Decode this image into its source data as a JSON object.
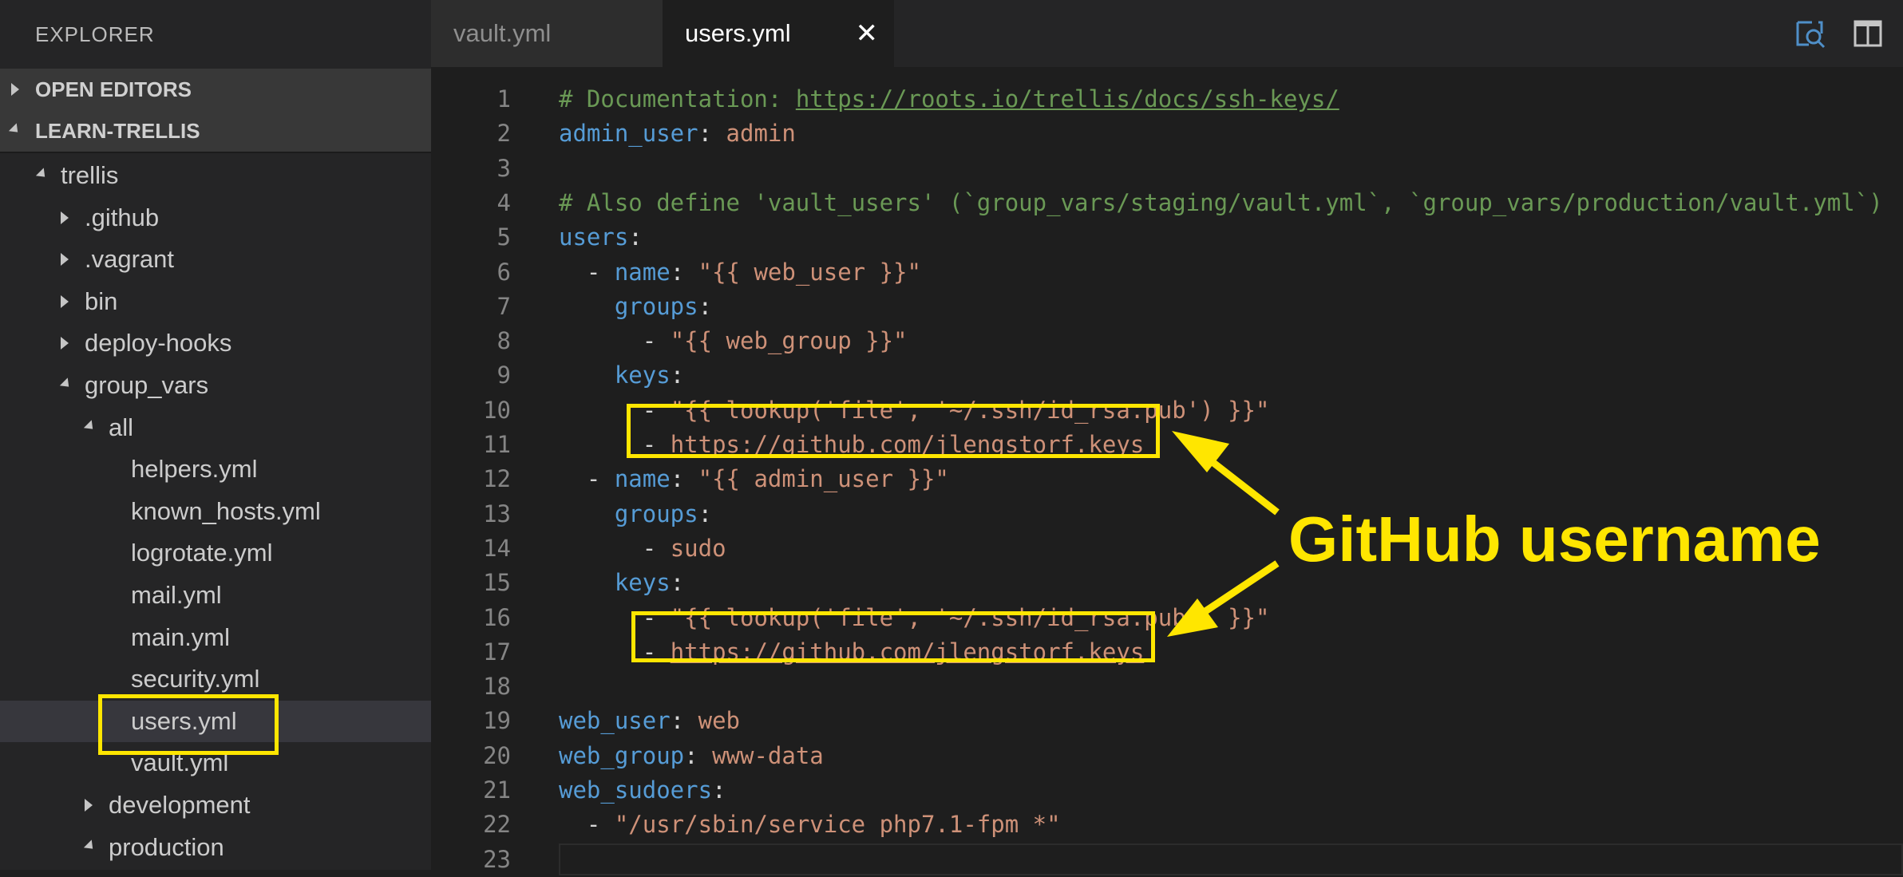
{
  "sidebar": {
    "title": "EXPLORER",
    "sections": [
      {
        "label": "OPEN EDITORS",
        "expanded": false
      },
      {
        "label": "LEARN-TRELLIS",
        "expanded": true
      }
    ],
    "tree": [
      {
        "label": "trellis",
        "type": "folder",
        "expanded": true
      },
      {
        "label": ".github",
        "type": "folder",
        "expanded": false
      },
      {
        "label": ".vagrant",
        "type": "folder",
        "expanded": false
      },
      {
        "label": "bin",
        "type": "folder",
        "expanded": false
      },
      {
        "label": "deploy-hooks",
        "type": "folder",
        "expanded": false
      },
      {
        "label": "group_vars",
        "type": "folder",
        "expanded": true
      },
      {
        "label": "all",
        "type": "folder",
        "expanded": true
      },
      {
        "label": "helpers.yml",
        "type": "file"
      },
      {
        "label": "known_hosts.yml",
        "type": "file"
      },
      {
        "label": "logrotate.yml",
        "type": "file"
      },
      {
        "label": "mail.yml",
        "type": "file"
      },
      {
        "label": "main.yml",
        "type": "file"
      },
      {
        "label": "security.yml",
        "type": "file"
      },
      {
        "label": "users.yml",
        "type": "file",
        "selected": true
      },
      {
        "label": "vault.yml",
        "type": "file"
      },
      {
        "label": "development",
        "type": "folder",
        "expanded": false
      },
      {
        "label": "production",
        "type": "folder",
        "expanded": true
      }
    ]
  },
  "tabs": [
    {
      "label": "vault.yml",
      "active": false
    },
    {
      "label": "users.yml",
      "active": true,
      "close": "✕"
    }
  ],
  "editor": {
    "lines": [
      {
        "n": "1",
        "parts": [
          {
            "t": "# Documentation: ",
            "c": "c"
          },
          {
            "t": "https://roots.io/trellis/docs/ssh-keys/",
            "c": "cl"
          }
        ]
      },
      {
        "n": "2",
        "parts": [
          {
            "t": "admin_user",
            "c": "k"
          },
          {
            "t": ": ",
            "c": "p"
          },
          {
            "t": "admin",
            "c": "s"
          }
        ]
      },
      {
        "n": "3",
        "parts": []
      },
      {
        "n": "4",
        "parts": [
          {
            "t": "# Also define 'vault_users' (`group_vars/staging/vault.yml`, `group_vars/production/vault.yml`)",
            "c": "c"
          }
        ]
      },
      {
        "n": "5",
        "parts": [
          {
            "t": "users",
            "c": "k"
          },
          {
            "t": ":",
            "c": "p"
          }
        ]
      },
      {
        "n": "6",
        "parts": [
          {
            "t": "  - ",
            "c": "p"
          },
          {
            "t": "name",
            "c": "k"
          },
          {
            "t": ": ",
            "c": "p"
          },
          {
            "t": "\"{{ web_user }}\"",
            "c": "s"
          }
        ]
      },
      {
        "n": "7",
        "parts": [
          {
            "t": "    ",
            "c": "p"
          },
          {
            "t": "groups",
            "c": "k"
          },
          {
            "t": ":",
            "c": "p"
          }
        ]
      },
      {
        "n": "8",
        "parts": [
          {
            "t": "      - ",
            "c": "p"
          },
          {
            "t": "\"{{ web_group }}\"",
            "c": "s"
          }
        ]
      },
      {
        "n": "9",
        "parts": [
          {
            "t": "    ",
            "c": "p"
          },
          {
            "t": "keys",
            "c": "k"
          },
          {
            "t": ":",
            "c": "p"
          }
        ]
      },
      {
        "n": "10",
        "parts": [
          {
            "t": "      - ",
            "c": "p"
          },
          {
            "t": "\"{{ lookup('file', '~/.ssh/id_rsa.pub') }}\"",
            "c": "s"
          }
        ]
      },
      {
        "n": "11",
        "parts": [
          {
            "t": "      - ",
            "c": "p"
          },
          {
            "t": "https://github.com/jlengstorf.keys",
            "c": "sl"
          }
        ]
      },
      {
        "n": "12",
        "parts": [
          {
            "t": "  - ",
            "c": "p"
          },
          {
            "t": "name",
            "c": "k"
          },
          {
            "t": ": ",
            "c": "p"
          },
          {
            "t": "\"{{ admin_user }}\"",
            "c": "s"
          }
        ]
      },
      {
        "n": "13",
        "parts": [
          {
            "t": "    ",
            "c": "p"
          },
          {
            "t": "groups",
            "c": "k"
          },
          {
            "t": ":",
            "c": "p"
          }
        ]
      },
      {
        "n": "14",
        "parts": [
          {
            "t": "      - ",
            "c": "p"
          },
          {
            "t": "sudo",
            "c": "s"
          }
        ]
      },
      {
        "n": "15",
        "parts": [
          {
            "t": "    ",
            "c": "p"
          },
          {
            "t": "keys",
            "c": "k"
          },
          {
            "t": ":",
            "c": "p"
          }
        ]
      },
      {
        "n": "16",
        "parts": [
          {
            "t": "      - ",
            "c": "p"
          },
          {
            "t": "\"{{ lookup('file', '~/.ssh/id_rsa.pub') }}\"",
            "c": "s"
          }
        ]
      },
      {
        "n": "17",
        "parts": [
          {
            "t": "      - ",
            "c": "p"
          },
          {
            "t": "https://github.com/jlengstorf.keys",
            "c": "sl"
          }
        ]
      },
      {
        "n": "18",
        "parts": []
      },
      {
        "n": "19",
        "parts": [
          {
            "t": "web_user",
            "c": "k"
          },
          {
            "t": ": ",
            "c": "p"
          },
          {
            "t": "web",
            "c": "s"
          }
        ]
      },
      {
        "n": "20",
        "parts": [
          {
            "t": "web_group",
            "c": "k"
          },
          {
            "t": ": ",
            "c": "p"
          },
          {
            "t": "www-data",
            "c": "s"
          }
        ]
      },
      {
        "n": "21",
        "parts": [
          {
            "t": "web_sudoers",
            "c": "k"
          },
          {
            "t": ":",
            "c": "p"
          }
        ]
      },
      {
        "n": "22",
        "parts": [
          {
            "t": "  - ",
            "c": "p"
          },
          {
            "t": "\"/usr/sbin/service php7.1-fpm *\"",
            "c": "s"
          }
        ]
      },
      {
        "n": "23",
        "parts": []
      }
    ]
  },
  "annotation": {
    "text": "GitHub username",
    "color": "#ffe600"
  }
}
